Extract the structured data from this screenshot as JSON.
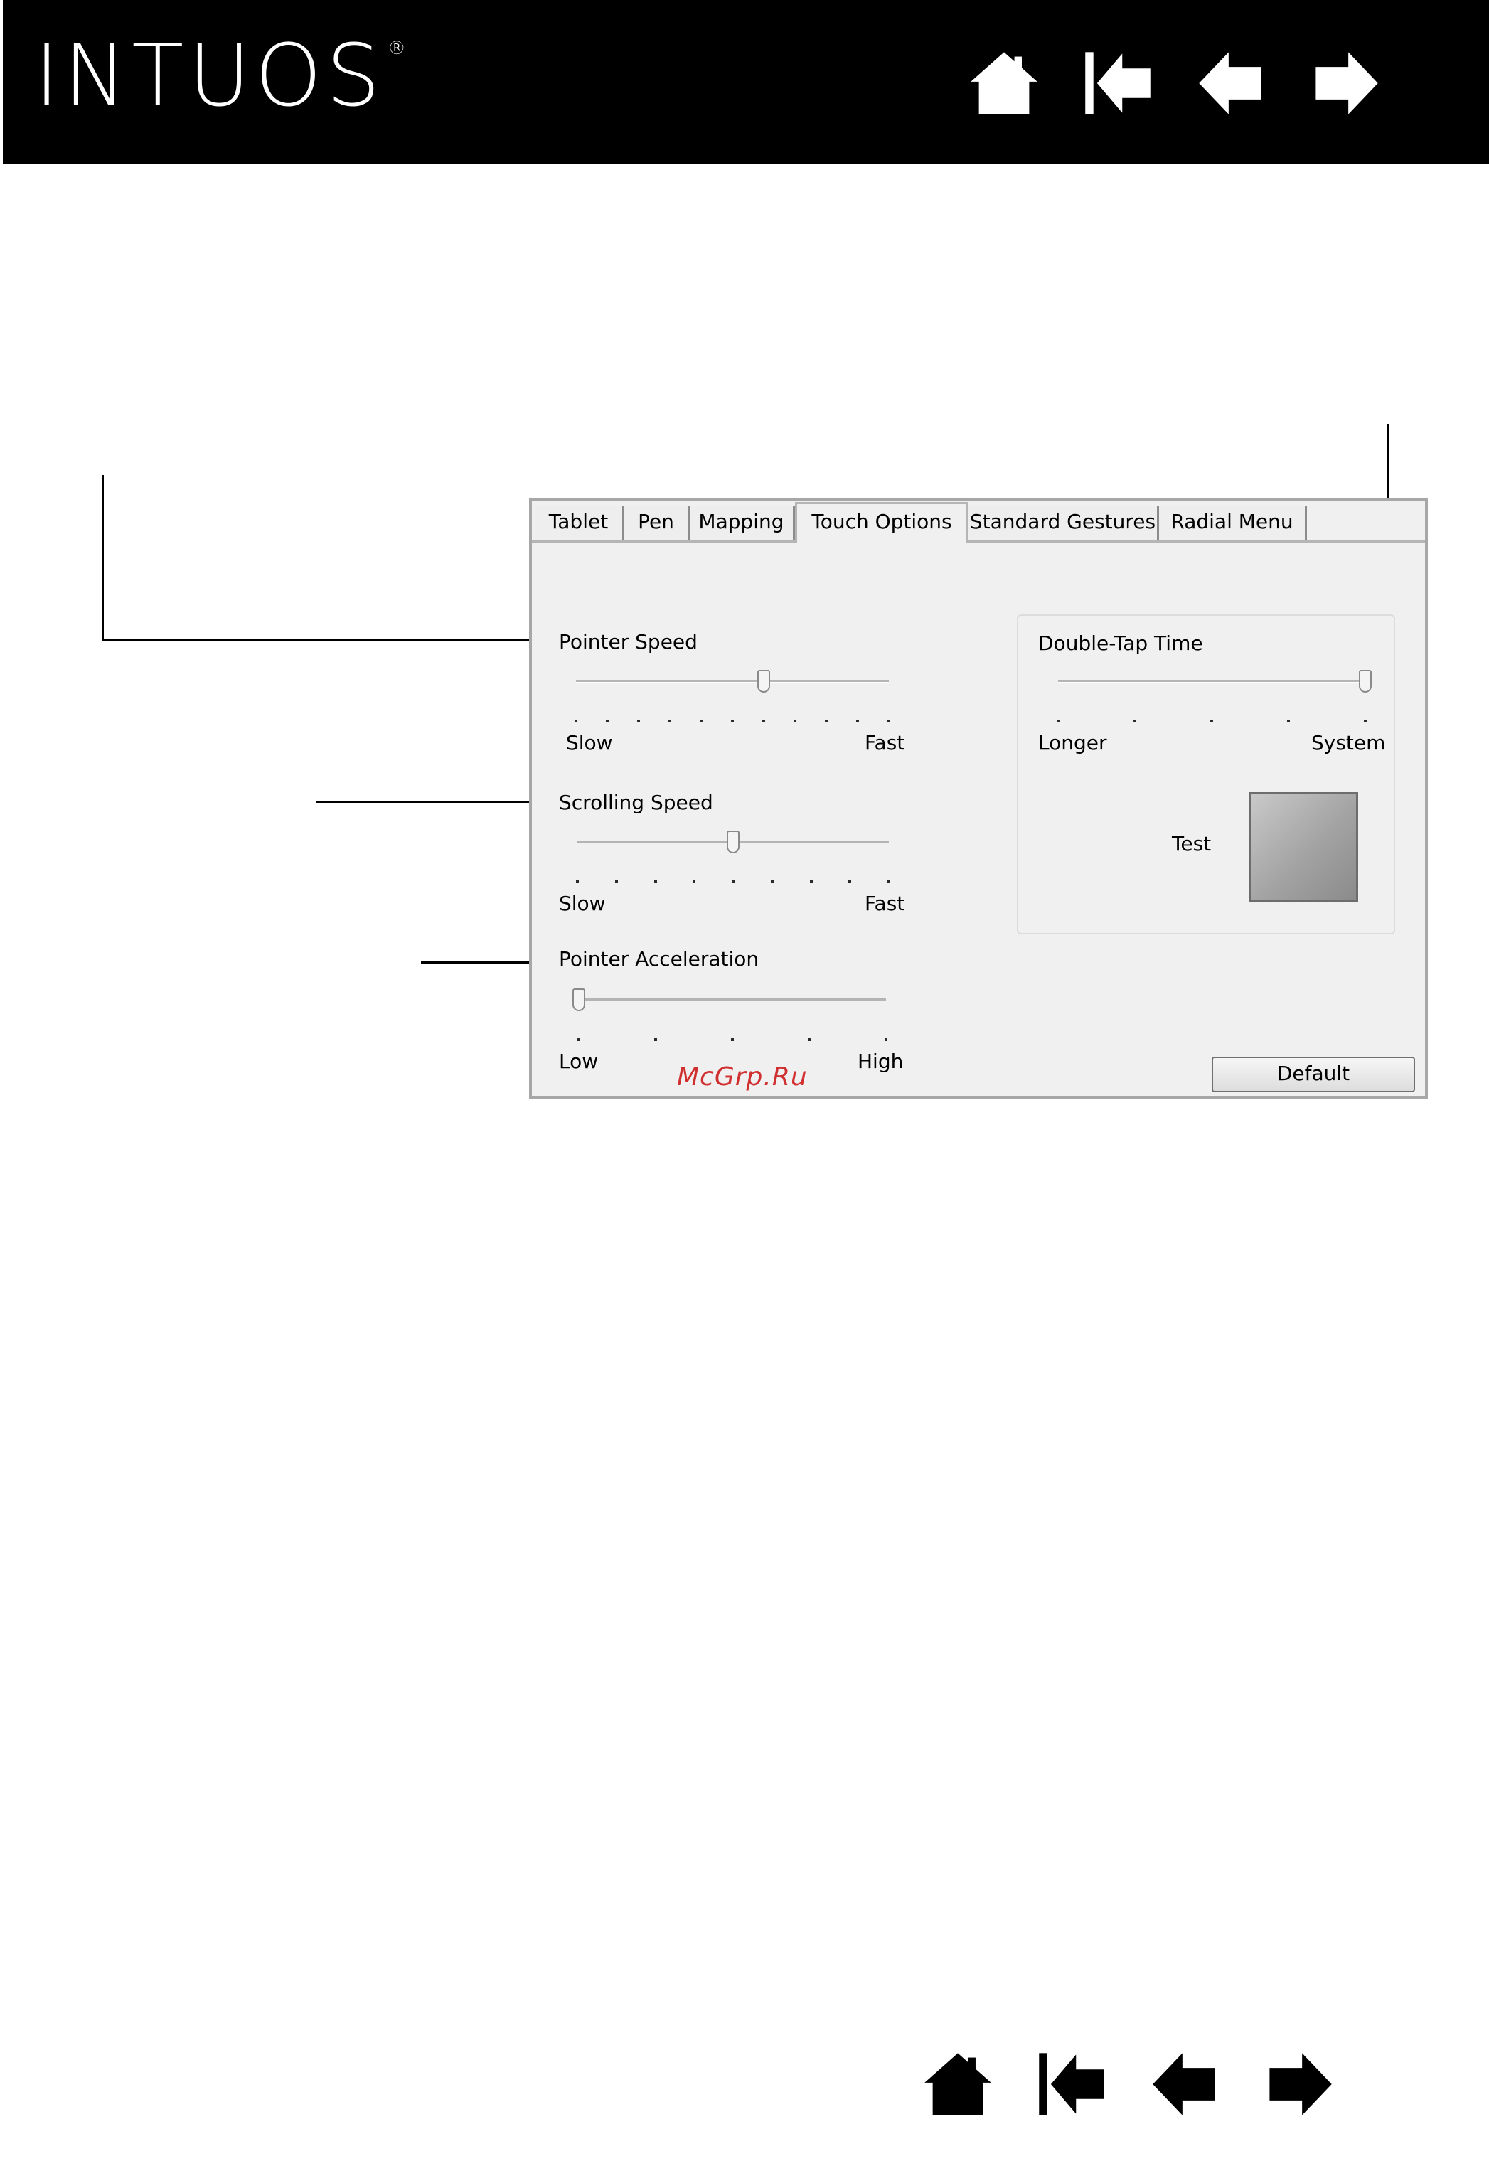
{
  "header": {
    "brand": "INTUOS",
    "brand_mark": "®",
    "nav_icons": [
      "home-icon",
      "first-page-icon",
      "previous-page-icon",
      "next-page-icon"
    ]
  },
  "dialog": {
    "tabs": [
      {
        "label": "Tablet",
        "active": false
      },
      {
        "label": "Pen",
        "active": false
      },
      {
        "label": "Mapping",
        "active": false
      },
      {
        "label": "Touch Options",
        "active": true
      },
      {
        "label": "Standard Gestures",
        "active": false
      },
      {
        "label": "Radial Menu",
        "active": false
      }
    ],
    "pointer_speed": {
      "label": "Pointer Speed",
      "min_label": "Slow",
      "max_label": "Fast",
      "ticks": 11,
      "value_fraction": 0.6
    },
    "scrolling_speed": {
      "label": "Scrolling Speed",
      "min_label": "Slow",
      "max_label": "Fast",
      "ticks": 9,
      "value_fraction": 0.5
    },
    "pointer_acceleration": {
      "label": "Pointer Acceleration",
      "min_label": "Low",
      "max_label": "High",
      "ticks": 5,
      "value_fraction": 0.0
    },
    "double_tap_time": {
      "label": "Double-Tap Time",
      "min_label": "Longer",
      "max_label": "System",
      "ticks": 5,
      "value_fraction": 1.0
    },
    "test_label": "Test",
    "default_button": "Default"
  },
  "watermark": "McGrp.Ru",
  "colors": {
    "header_bg": "#000000",
    "dialog_bg": "#f0f0f0",
    "watermark": "#d03030"
  }
}
